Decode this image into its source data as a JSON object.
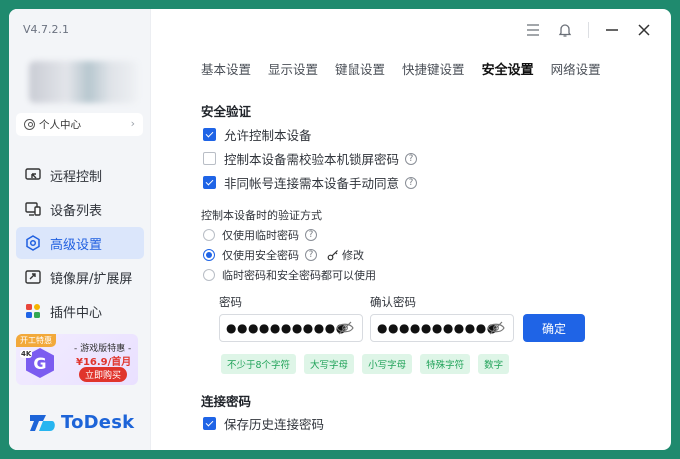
{
  "app": {
    "version": "V4.7.2.1",
    "brand": "ToDesk",
    "accent_color": "#1f64e6"
  },
  "sidebar": {
    "profile_label": "个人中心",
    "items": [
      {
        "label": "远程控制",
        "icon": "remote-control-icon"
      },
      {
        "label": "设备列表",
        "icon": "device-list-icon"
      },
      {
        "label": "高级设置",
        "icon": "advanced-settings-icon",
        "active": true
      },
      {
        "label": "镜像屏/扩展屏",
        "icon": "mirror-screen-icon"
      },
      {
        "label": "插件中心",
        "icon": "plugin-center-icon"
      }
    ],
    "promo": {
      "tag": "开工特惠",
      "line1": "- 游戏版特惠 -",
      "price": "¥16.9/首月",
      "button": "立即购买",
      "badge": "4K",
      "logo_letter": "G"
    }
  },
  "tabs": [
    {
      "label": "基本设置"
    },
    {
      "label": "显示设置"
    },
    {
      "label": "键鼠设置"
    },
    {
      "label": "快捷键设置"
    },
    {
      "label": "安全设置",
      "active": true
    },
    {
      "label": "网络设置"
    }
  ],
  "security": {
    "title": "安全验证",
    "options": [
      {
        "label": "允许控制本设备",
        "checked": true
      },
      {
        "label": "控制本设备需校验本机锁屏密码",
        "checked": false,
        "help": true
      },
      {
        "label": "非同帐号连接需本设备手动同意",
        "checked": true,
        "help": true
      }
    ],
    "verify_label": "控制本设备时的验证方式",
    "verify_options": [
      {
        "label": "仅使用临时密码",
        "selected": false
      },
      {
        "label": "仅使用安全密码",
        "selected": true
      },
      {
        "label": "临时密码和安全密码都可以使用",
        "selected": false
      }
    ],
    "modify_label": "修改",
    "password_label": "密码",
    "password_value": "●●●●●●●●●●●",
    "confirm_password_label": "确认密码",
    "confirm_password_value": "●●●●●●●●●●●",
    "confirm_button": "确定",
    "hints": [
      "不少于8个字符",
      "大写字母",
      "小写字母",
      "特殊字符",
      "数字"
    ],
    "help_glyph": "?"
  },
  "connection_password": {
    "title": "连接密码",
    "save_history_label": "保存历史连接密码",
    "save_history_checked": true
  }
}
